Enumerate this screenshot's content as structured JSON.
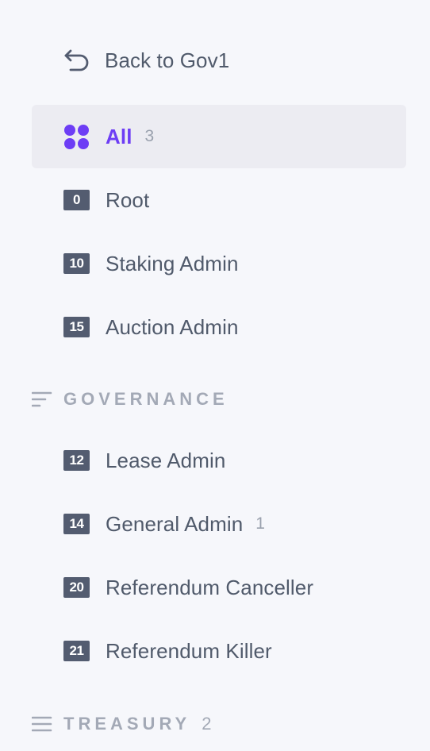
{
  "back": {
    "label": "Back to Gov1",
    "icon": "undo-arrow-icon"
  },
  "tracks": [
    {
      "label": "All",
      "count": "3",
      "icon": "grid-dots-icon",
      "active": true
    },
    {
      "label": "Root",
      "badge": "0"
    },
    {
      "label": "Staking Admin",
      "badge": "10"
    },
    {
      "label": "Auction Admin",
      "badge": "15"
    }
  ],
  "sections": {
    "governance": {
      "title": "GOVERNANCE",
      "icon": "sort-lines-icon",
      "items": [
        {
          "label": "Lease Admin",
          "badge": "12"
        },
        {
          "label": "General Admin",
          "badge": "14",
          "count": "1"
        },
        {
          "label": "Referendum Canceller",
          "badge": "20"
        },
        {
          "label": "Referendum Killer",
          "badge": "21"
        }
      ]
    },
    "treasury": {
      "title": "TREASURY",
      "count": "2",
      "icon": "menu-lines-icon"
    }
  },
  "colors": {
    "accent": "#6d3df5",
    "badge_bg": "#535c70",
    "active_bg": "#ececf2",
    "text": "#505a6b",
    "muted": "#a3a9b6",
    "background": "#f6f7fb"
  }
}
